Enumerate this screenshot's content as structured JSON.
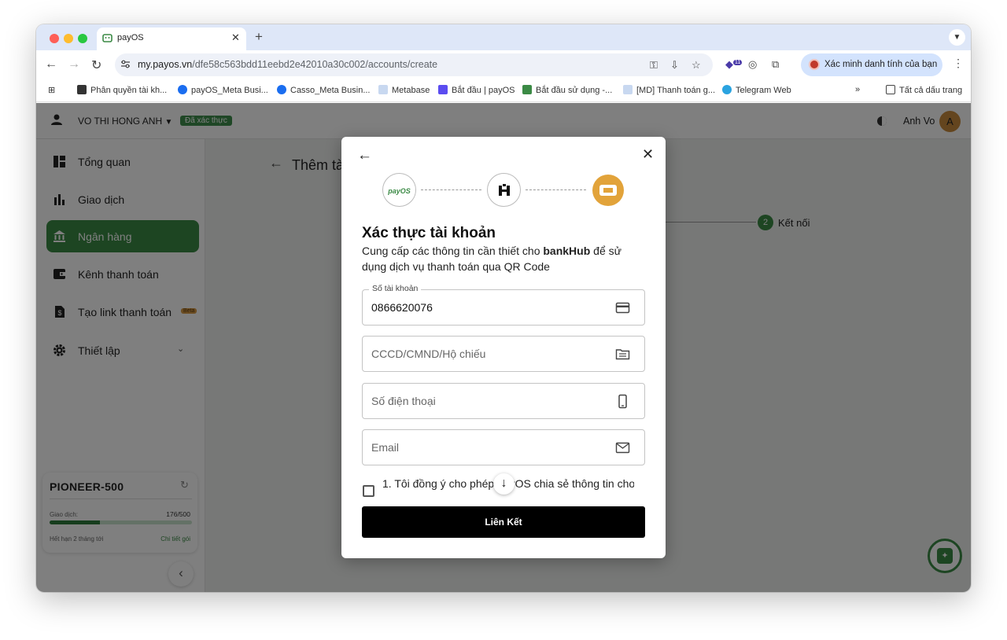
{
  "browser": {
    "tab_title": "payOS",
    "tab_close": "✕",
    "new_tab": "+",
    "url_host": "my.payos.vn",
    "url_path": "/dfe58c563bdd11eebd2e42010a30c002/accounts/create",
    "extension_badge": "11",
    "profile_label": "Xác minh danh tính của bạn",
    "bookmarks": [
      {
        "label": "Phân quyền tài kh..."
      },
      {
        "label": "payOS_Meta Busi..."
      },
      {
        "label": "Casso_Meta Busin..."
      },
      {
        "label": "Metabase"
      },
      {
        "label": "Bắt đầu | payOS"
      },
      {
        "label": "Bắt đầu sử dụng -..."
      },
      {
        "label": "[MD] Thanh toán g..."
      },
      {
        "label": "Telegram Web"
      }
    ],
    "bookmarks_overflow": "»",
    "all_bookmarks": "Tất cả dấu trang"
  },
  "topbar": {
    "user_name": "VO THI HONG ANH",
    "verified_badge": "Đã xác thực",
    "display_name": "Anh Vo",
    "avatar_letter": "A"
  },
  "sidebar": {
    "items": [
      {
        "label": "Tổng quan",
        "icon": "dashboard-icon"
      },
      {
        "label": "Giao dịch",
        "icon": "bar-chart-icon"
      },
      {
        "label": "Ngân hàng",
        "icon": "bank-icon",
        "active": true
      },
      {
        "label": "Kênh thanh toán",
        "icon": "wallet-icon"
      },
      {
        "label": "Tạo link thanh toán",
        "icon": "document-dollar-icon",
        "badge": "Beta"
      },
      {
        "label": "Thiết lập",
        "icon": "gear-icon"
      }
    ],
    "plan": {
      "name": "PIONEER-500",
      "usage_label": "Giao dịch:",
      "usage_value": "176/500",
      "usage_fraction": 0.352,
      "expiry": "Hết hạn 2 tháng tới",
      "detail_link": "Chi tiết gói"
    }
  },
  "main": {
    "title": "Thêm tà",
    "step_number": "2",
    "step_label": "Kết nối"
  },
  "modal": {
    "logo_payos": "payOS",
    "title": "Xác thực tài khoản",
    "subtitle_before": "Cung cấp các thông tin cần thiết cho ",
    "subtitle_bold": "bankHub",
    "subtitle_after": " để sử dụng dịch vụ thanh toán qua QR Code",
    "fields": {
      "account": {
        "label": "Số tài khoản",
        "value": "0866620076"
      },
      "id_card": {
        "placeholder": "CCCD/CMND/Hộ chiếu"
      },
      "phone": {
        "placeholder": "Số điện thoại"
      },
      "email": {
        "placeholder": "Email"
      }
    },
    "agreement_text": "1. Tôi đồng ý cho phép payOS chia sẻ thông tin cho",
    "submit_label": "Liên Kết"
  },
  "colors": {
    "brand_green": "#3b8a45",
    "bank_logo_orange": "#e2a33a"
  }
}
